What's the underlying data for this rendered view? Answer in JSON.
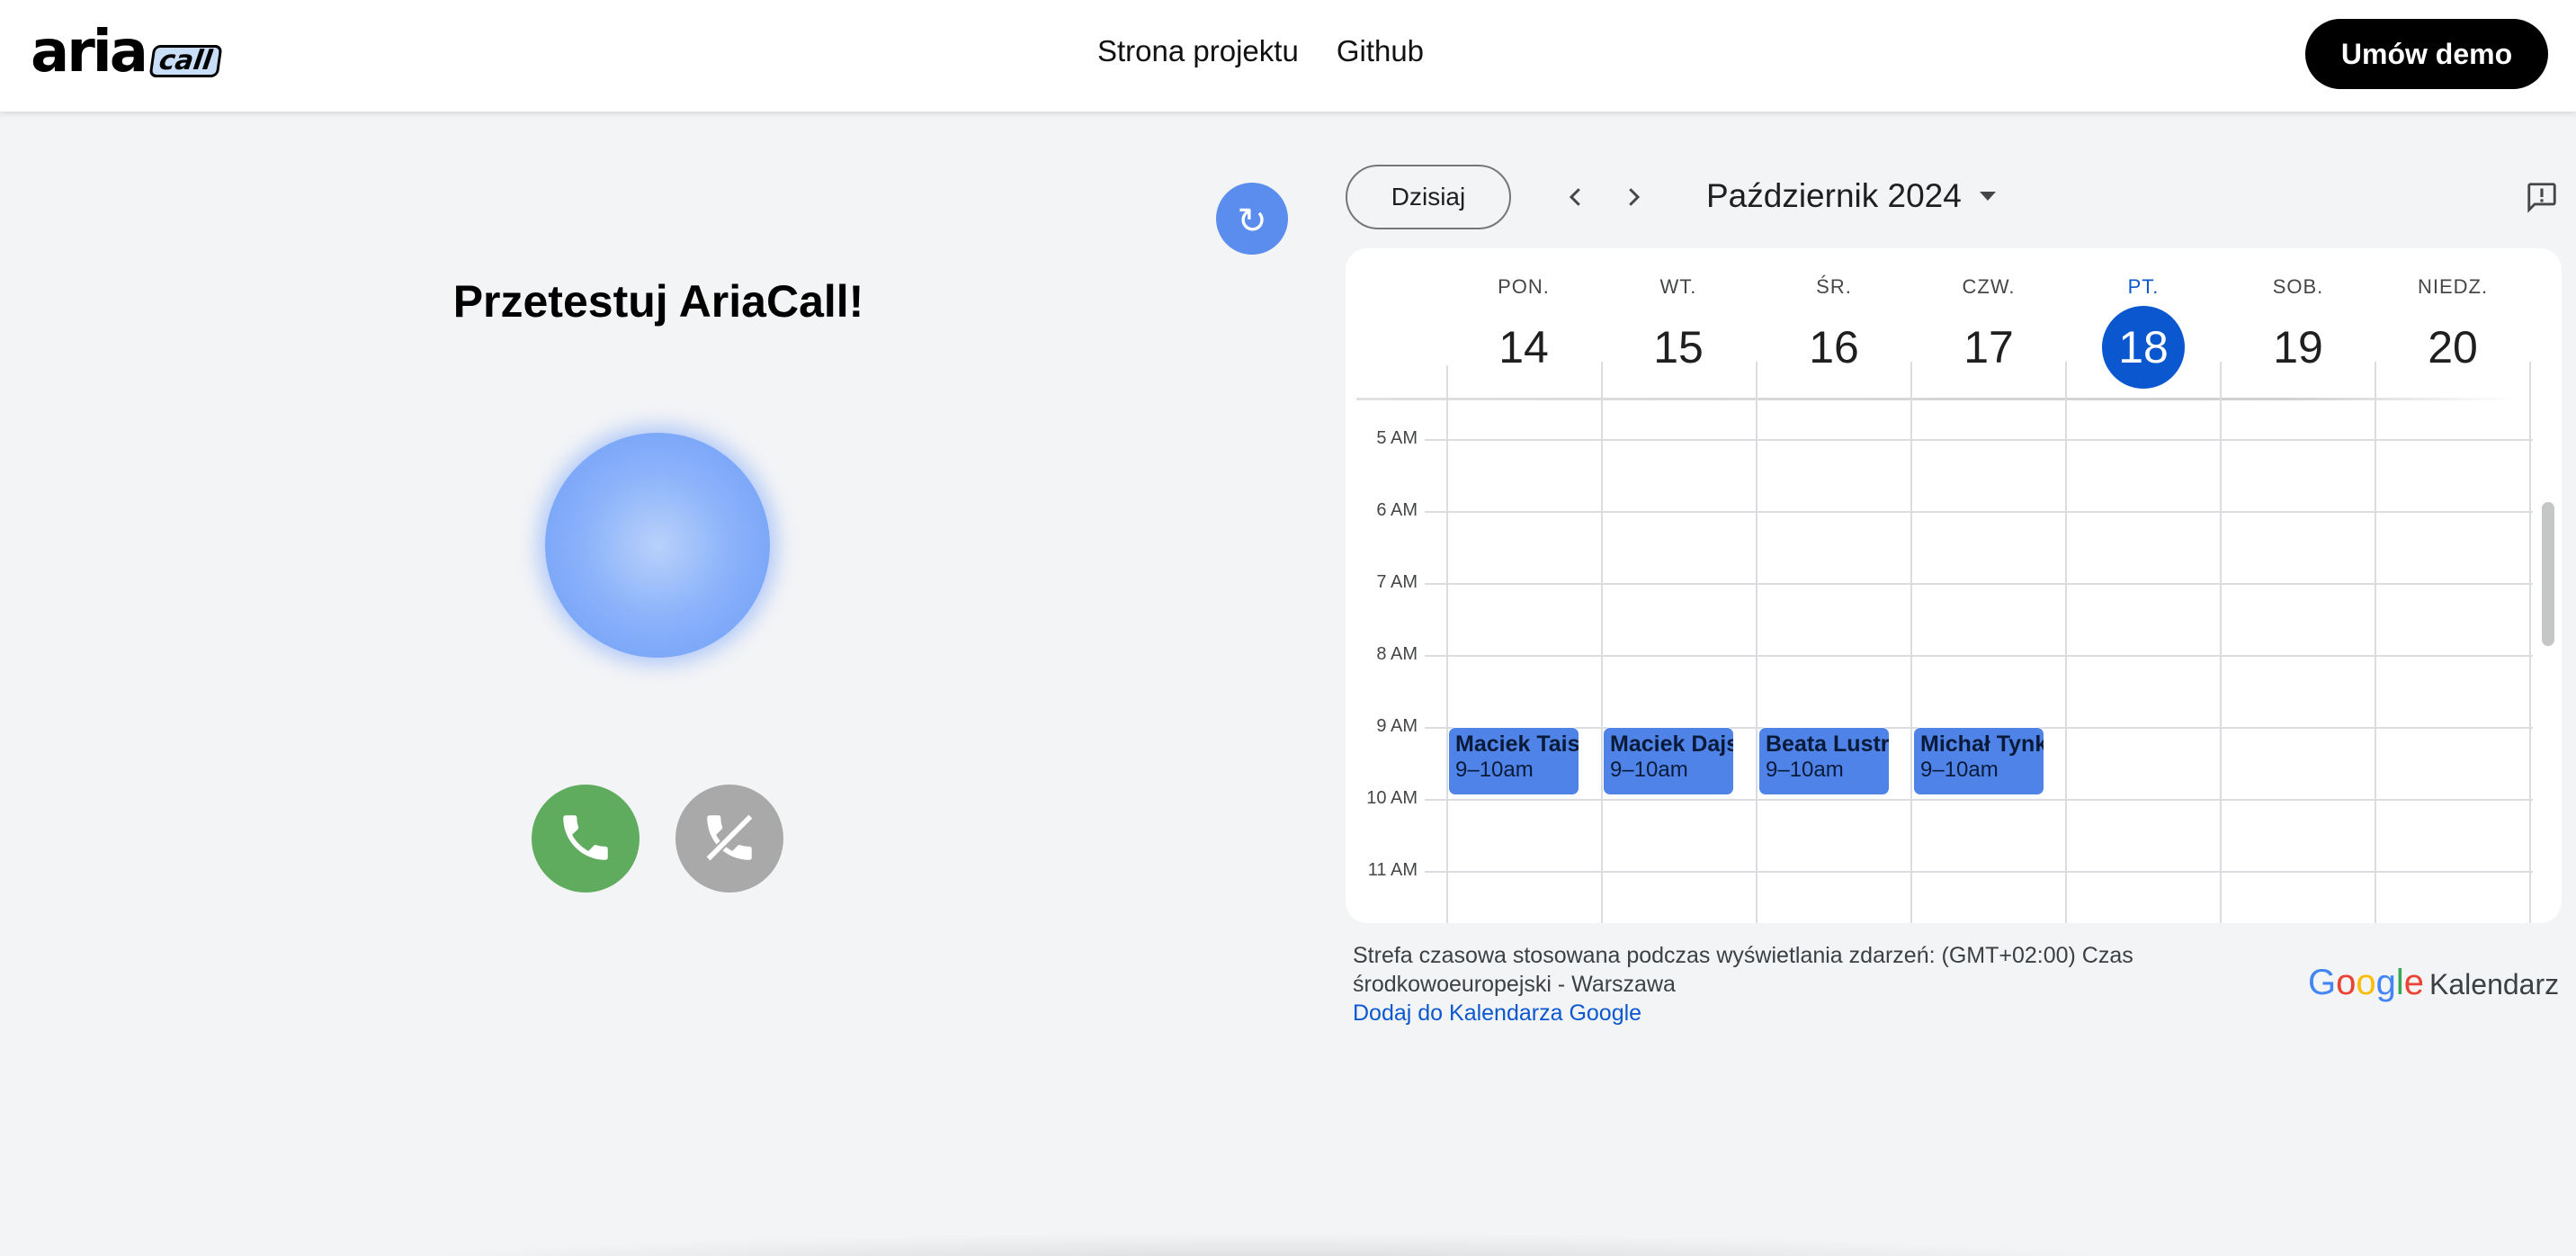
{
  "header": {
    "logo_text": "aria",
    "logo_badge": "call",
    "nav": [
      "Strona projektu",
      "Github"
    ],
    "cta_label": "Umów demo"
  },
  "left": {
    "title": "Przetestuj AriaCall!",
    "refresh_icon": "↻",
    "answer_icon": "phone-icon",
    "hangup_icon": "phone-off-icon",
    "colors": {
      "answer": "#5fac5f",
      "hangup": "#a9a9a9",
      "orb": "#8cb3fa",
      "refresh": "#5b8def"
    }
  },
  "calendar": {
    "today_label": "Dzisiaj",
    "month_label": "Październik 2024",
    "days": [
      {
        "name": "PON.",
        "num": "14"
      },
      {
        "name": "WT.",
        "num": "15"
      },
      {
        "name": "ŚR.",
        "num": "16"
      },
      {
        "name": "CZW.",
        "num": "17"
      },
      {
        "name": "PT.",
        "num": "18",
        "today": true
      },
      {
        "name": "SOB.",
        "num": "19"
      },
      {
        "name": "NIEDZ.",
        "num": "20"
      }
    ],
    "times": [
      "5 AM",
      "6 AM",
      "7 AM",
      "8 AM",
      "9 AM",
      "10 AM",
      "11 AM"
    ],
    "events": [
      {
        "day": 0,
        "title": "Maciek Taisc",
        "time": "9–10am"
      },
      {
        "day": 1,
        "title": "Maciek Dajs",
        "time": "9–10am"
      },
      {
        "day": 2,
        "title": "Beata Lustro",
        "time": "9–10am"
      },
      {
        "day": 3,
        "title": "Michał Tynk",
        "time": "9–10am"
      }
    ],
    "timezone_text": "Strefa czasowa stosowana podczas wyświetlania zdarzeń: (GMT+02:00) Czas środkowoeuropejski - Warszawa",
    "add_link": "Dodaj do Kalendarza Google",
    "brand_google": "Google",
    "brand_product": "Kalendarz",
    "accent": "#0b57d0",
    "event_color": "#4f83e8"
  }
}
